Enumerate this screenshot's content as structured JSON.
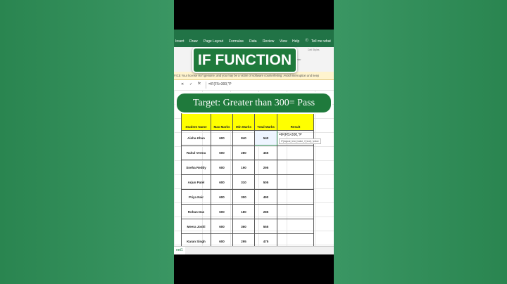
{
  "overlay": {
    "title": "IF FUNCTION",
    "target": "Target: Greater than 300= Pass"
  },
  "ribbon": {
    "tabs": [
      "Insert",
      "Draw",
      "Page Layout",
      "Formulas",
      "Data",
      "Review",
      "View",
      "Help",
      "Tell me what"
    ],
    "cell_styles": "Cell Styles",
    "center": "Center"
  },
  "warning": {
    "text": "FICE  Your license isn't genuine, and you may be a victim of software counterfeiting. Avoid interruption and keep"
  },
  "formula_bar": {
    "cancel": "✕",
    "enter": "✓",
    "fx": "fx",
    "formula": "=IF(F5>300,\"P"
  },
  "table": {
    "headers": [
      "Student Name",
      "Max Marks",
      "Min Marks",
      "Total Marks",
      "Result"
    ],
    "rows": [
      {
        "name": "Aisha Khan",
        "max": "600",
        "min": "840",
        "total": "540"
      },
      {
        "name": "Rahul Verma",
        "max": "600",
        "min": "280",
        "total": "455"
      },
      {
        "name": "Sneha Reddy",
        "max": "600",
        "min": "190",
        "total": "295"
      },
      {
        "name": "Arjun Patel",
        "max": "600",
        "min": "310",
        "total": "505"
      },
      {
        "name": "Priya Nair",
        "max": "600",
        "min": "300",
        "total": "490"
      },
      {
        "name": "Rohan Das",
        "max": "600",
        "min": "180",
        "total": "285"
      },
      {
        "name": "Meera Joshi",
        "max": "600",
        "min": "360",
        "total": "555"
      },
      {
        "name": "Karan Singh",
        "max": "600",
        "min": "295",
        "total": "475"
      }
    ],
    "editing_formula": "=IF(F5>300,\"P",
    "tooltip": "IF(logical_test, [value_if_true], [value"
  },
  "sheet_tab": "eet1"
}
